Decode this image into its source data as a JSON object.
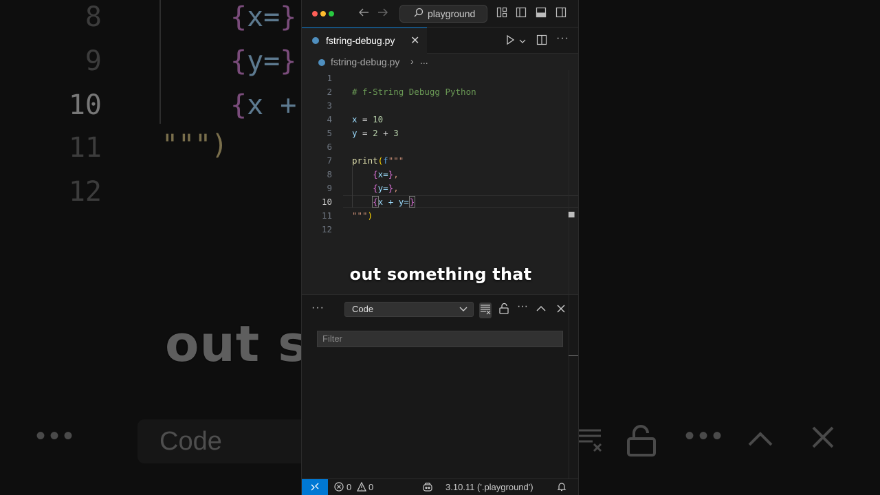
{
  "background": {
    "line_numbers": [
      "8",
      "9",
      "10",
      "11",
      "12"
    ],
    "code_lines": [
      {
        "brace_open": "{",
        "var": "x=",
        "brace_close": "}"
      },
      {
        "brace_open": "{",
        "var": "y=",
        "brace_close": "}"
      },
      {
        "brace_open": "{",
        "var": "x +",
        "brace_close": ""
      }
    ],
    "string_close": "\"\"\")",
    "caption": "out s        that",
    "panel": {
      "dots": "•••",
      "select_value": "Code"
    }
  },
  "titlebar": {
    "command_center": "playground",
    "icons": [
      "back-arrow-icon",
      "forward-arrow-icon",
      "search-icon",
      "customize-layout-icon",
      "toggle-primary-sidebar-icon",
      "toggle-panel-icon",
      "toggle-secondary-sidebar-icon"
    ]
  },
  "tab": {
    "label": "fstring-debug.py",
    "close": "✕"
  },
  "breadcrumbs": {
    "file": "fstring-debug.py",
    "separator": "›",
    "more": "..."
  },
  "editor": {
    "current_line": "10",
    "lines": [
      {
        "n": "1"
      },
      {
        "n": "2",
        "comment": "# f-String Debugg Python"
      },
      {
        "n": "3"
      },
      {
        "n": "4",
        "var": "x",
        "op": " = ",
        "num": "10"
      },
      {
        "n": "5",
        "var": "y",
        "op": " = ",
        "num": "2",
        "op2": " + ",
        "num2": "3"
      },
      {
        "n": "6"
      },
      {
        "n": "7",
        "fn": "print",
        "paren": "(",
        "prefix": "f",
        "str": "\"\"\""
      },
      {
        "n": "8",
        "indent": "    ",
        "brace_open": "{",
        "expr": "x=",
        "brace_close": "}",
        "tail": ","
      },
      {
        "n": "9",
        "indent": "    ",
        "brace_open": "{",
        "expr": "y=",
        "brace_close": "}",
        "tail": ","
      },
      {
        "n": "10",
        "indent": "    ",
        "brace_open": "{",
        "expr": "x + y=",
        "brace_close": "}",
        "tail": ""
      },
      {
        "n": "11",
        "str": "\"\"\"",
        "paren": ")"
      },
      {
        "n": "12"
      }
    ]
  },
  "caption": "out something that",
  "panel": {
    "more": "···",
    "select_value": "Code",
    "filter_placeholder": "Filter",
    "icons": [
      "clear-output-icon",
      "lock-scroll-icon",
      "more-actions-icon",
      "maximize-panel-icon",
      "close-panel-icon"
    ]
  },
  "statusbar": {
    "errors": "0",
    "warnings": "0",
    "interpreter": "3.10.11 ('.playground')"
  },
  "colors": {
    "accent": "#0078d4",
    "comment": "#6a9955",
    "variable": "#9cdcfe",
    "number": "#b5cea8",
    "function": "#dcdcaa",
    "string": "#ce9178",
    "brace": "#da70d6",
    "paren": "#ffd700"
  }
}
